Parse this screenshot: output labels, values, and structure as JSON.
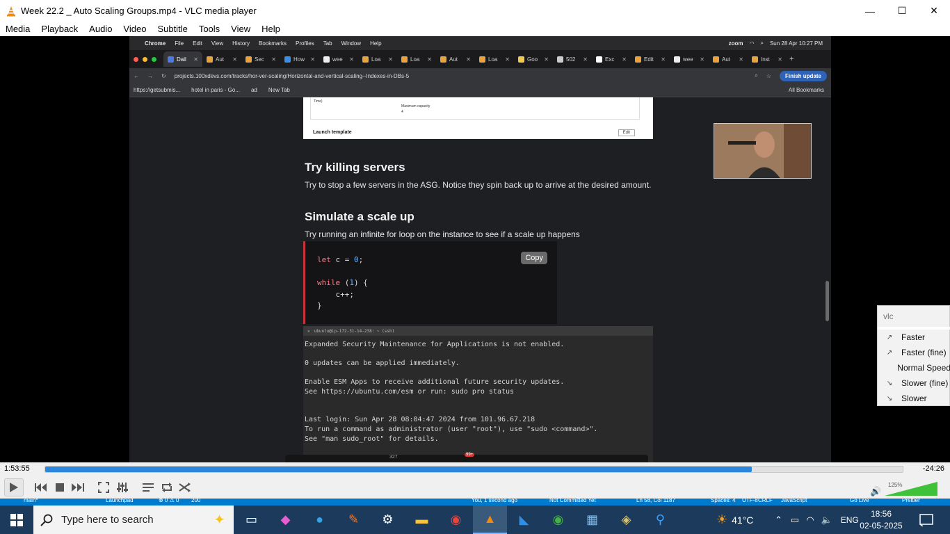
{
  "window": {
    "title": "Week 22.2 _ Auto Scaling Groups.mp4 - VLC media player",
    "minimize": "—",
    "maximize": "☐",
    "close": "✕"
  },
  "menu": [
    "Media",
    "Playback",
    "Audio",
    "Video",
    "Subtitle",
    "Tools",
    "View",
    "Help"
  ],
  "mac": {
    "menubar": [
      "Chrome",
      "File",
      "Edit",
      "View",
      "History",
      "Bookmarks",
      "Profiles",
      "Tab",
      "Window",
      "Help"
    ],
    "app_zoom": "zoom",
    "datetime": "Sun 28 Apr  10:27 PM",
    "tabs": [
      "Dail",
      "Aut",
      "Sec",
      "How",
      "wee",
      "Loa",
      "Loa",
      "Aut",
      "Loa",
      "Goo",
      "502",
      "Exc",
      "Edit",
      "wee",
      "Aut",
      "Inst"
    ],
    "url": "projects.100xdevs.com/tracks/hor-ver-scaling/Horizontal-and-vertical-scaling--Indexes-in-DBs-5",
    "finish_update": "Finish update",
    "bookmarks": [
      "https://getsubmis...",
      "hotel in paris - Go...",
      "ad",
      "New Tab"
    ],
    "all_bookmarks": "All Bookmarks"
  },
  "page": {
    "img_time": "Time)",
    "img_maxcap": "Maximum capacity",
    "img_maxval": "4",
    "img_launch": "Launch template",
    "img_edit": "Edit",
    "h_kill": "Try killing servers",
    "p_kill": "Try to stop a few servers in the ASG. Notice they spin back up to arrive at the desired amount.",
    "h_scale": "Simulate a scale up",
    "p_scale": "Try running an infinite for loop on the instance to see if a scale up happens",
    "copy": "Copy",
    "code_let": "let",
    "code_c": " c = ",
    "code_zero": "0",
    "code_semi": ";",
    "code_while": "while",
    "code_paren_open": " (",
    "code_one": "1",
    "code_paren_close": ") {",
    "code_inc": "    c++;",
    "code_close": "}",
    "term_title": "ubuntu@ip-172-31-14-238: ~ (ssh)",
    "term_lines": [
      "Expanded Security Maintenance for Applications is not enabled.",
      "0 updates can be applied immediately.",
      "Enable ESM Apps to receive additional future security updates.",
      "See https://ubuntu.com/esm or run: sudo pro status",
      "Last login: Sun Apr 28 08:04:47 2024 from 101.96.67.218",
      "To run a command as administrator (user \"root\"), use \"sudo <command>\".",
      "See \"man sudo_root\" for details."
    ],
    "zoom_participants": "327",
    "zoom_badge": "99+"
  },
  "player": {
    "elapsed": "1:53:55",
    "remaining": "-24:26",
    "progress": 0.824,
    "volume_pct": "125%",
    "volume": 1.25
  },
  "vscode_status": {
    "branch": "main*",
    "launchpad": "Launchpad",
    "problems": "⊗ 0 ⚠ 0",
    "port": "200",
    "blame": "You, 1 second ago",
    "not_committed": "Not Committed Yet",
    "position": "Ln 58, Col 1187",
    "spaces": "Spaces: 4",
    "encoding": "UTF-8",
    "eol": "CRLF",
    "language": "JavaScript",
    "golive": "Go Live",
    "prettier": "Prettier"
  },
  "speed_popup": {
    "filter": "vlc",
    "items": [
      "Faster",
      "Faster (fine)",
      "Normal Speed",
      "Slower (fine)",
      "Slower"
    ]
  },
  "taskbar": {
    "search_placeholder": "Type here to search",
    "temperature": "41°C",
    "language": "ENG",
    "time": "18:56",
    "date": "02-05-2025"
  },
  "colors": {
    "seek": "#2b86dc",
    "taskbar": "#1b3a5c",
    "code_keyword": "#f47c84",
    "code_number": "#6fb3ff"
  }
}
